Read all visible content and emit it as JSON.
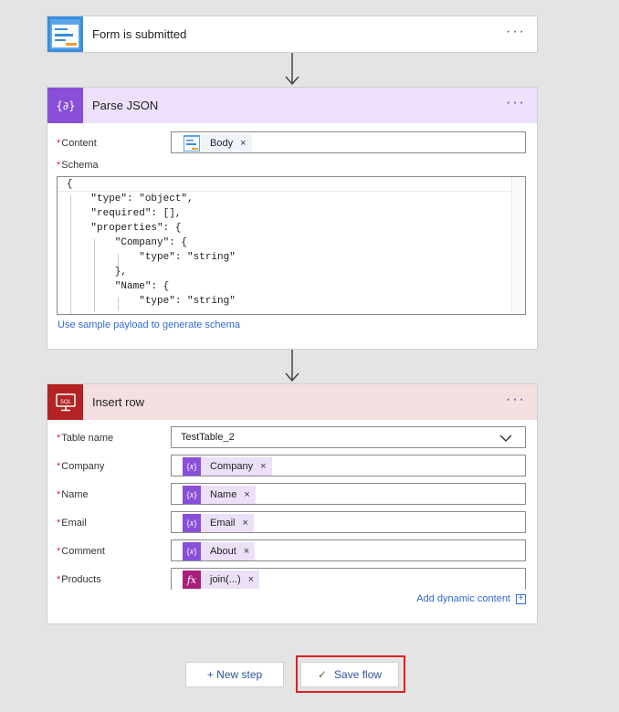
{
  "trigger": {
    "title": "Form is submitted"
  },
  "parse_json": {
    "title": "Parse JSON",
    "content_label": "Content",
    "content_token": "Body",
    "schema_label": "Schema",
    "schema_lines": [
      "{",
      "    \"type\": \"object\",",
      "    \"required\": [],",
      "    \"properties\": {",
      "        \"Company\": {",
      "            \"type\": \"string\"",
      "        },",
      "        \"Name\": {",
      "            \"type\": \"string\""
    ],
    "sample_link": "Use sample payload to generate schema"
  },
  "insert_row": {
    "title": "Insert row",
    "table_label": "Table name",
    "table_value": "TestTable_2",
    "fields": [
      {
        "label": "Company",
        "token": "Company",
        "kind": "var"
      },
      {
        "label": "Name",
        "token": "Name",
        "kind": "var"
      },
      {
        "label": "Email",
        "token": "Email",
        "kind": "var"
      },
      {
        "label": "Comment",
        "token": "About",
        "kind": "var"
      },
      {
        "label": "Products",
        "token": "join(...)",
        "kind": "fx"
      }
    ],
    "add_dynamic": "Add dynamic content"
  },
  "common": {
    "required_mark": "*",
    "more": "···",
    "remove": "×",
    "fx": "fx",
    "var_glyph": "{𝑥}"
  },
  "footer": {
    "new_step": "+ New step",
    "save_flow": "Save flow",
    "save_check": "✓"
  },
  "colors": {
    "parse_accent": "#8a4fd8",
    "sql_accent": "#b42323",
    "highlight": "#e02020"
  }
}
